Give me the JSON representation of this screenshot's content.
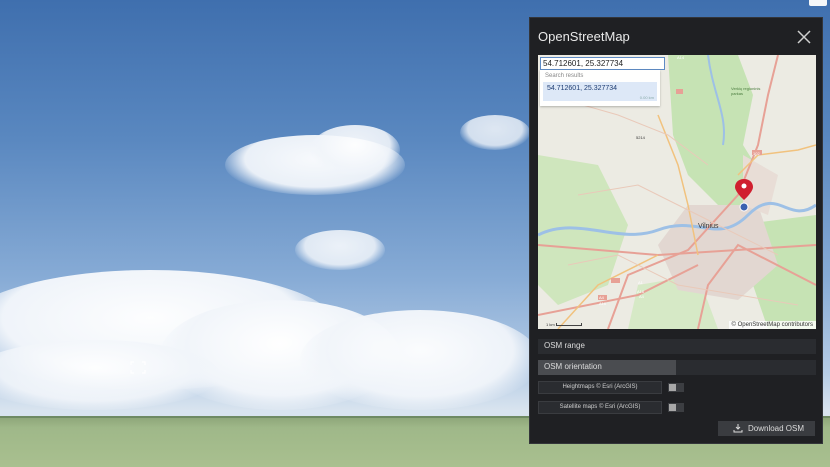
{
  "dialog": {
    "title": "OpenStreetMap",
    "close_icon": "close-icon"
  },
  "map": {
    "search_value": "54.712601, 25.327734",
    "results_title": "Search results",
    "result_text": "54.712601, 25.327734",
    "result_distance": "0.00 km",
    "city_label": "Vilnius",
    "attribution": "© OpenStreetMap contributors",
    "road_labels": [
      "A14",
      "5214",
      "A1",
      "A4",
      "A16",
      "A4",
      "A16",
      "102"
    ],
    "park_label": "Verkių regioninis parkas",
    "pin_icon": "map-pin-icon"
  },
  "controls": {
    "range_label": "OSM range",
    "orientation_label": "OSM orientation",
    "heightmaps_label": "Heightmaps © Esri (ArcGIS)",
    "satellite_label": "Satellite maps © Esri (ArcGIS)",
    "download_label": "Download OSM",
    "download_icon": "download-icon"
  },
  "colors": {
    "panel_bg": "#1f2023",
    "row_bg": "#2a2c30",
    "accent_pin": "#d01f2f"
  }
}
